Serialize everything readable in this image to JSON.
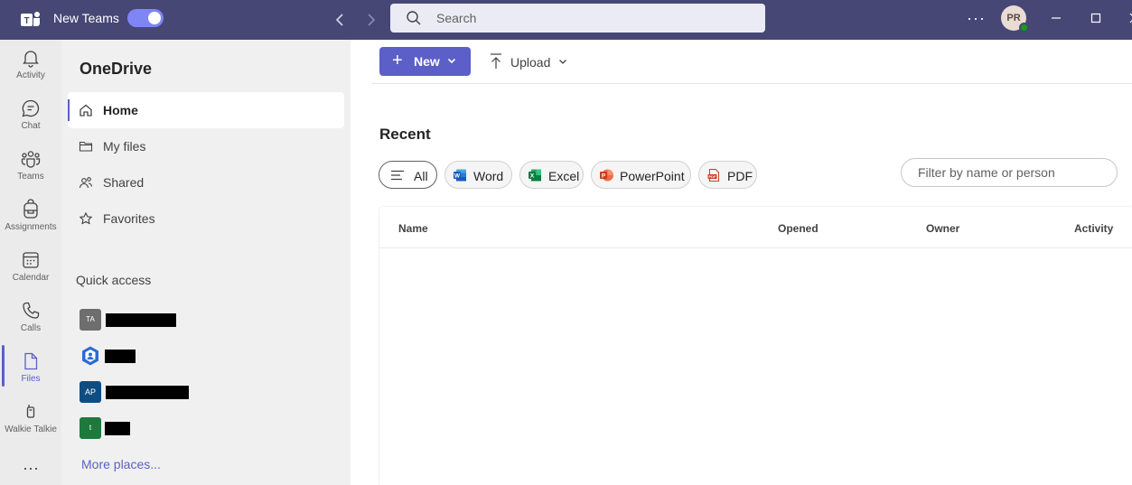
{
  "titlebar": {
    "new_teams_label": "New Teams",
    "toggle_on": true,
    "search_placeholder": "Search",
    "more": "···",
    "avatar_initials": "PR",
    "accent": "#464775"
  },
  "rail": {
    "items": [
      {
        "label": "Activity",
        "icon": "bell-icon"
      },
      {
        "label": "Chat",
        "icon": "chat-icon"
      },
      {
        "label": "Teams",
        "icon": "teams-icon"
      },
      {
        "label": "Assignments",
        "icon": "backpack-icon"
      },
      {
        "label": "Calendar",
        "icon": "calendar-icon"
      },
      {
        "label": "Calls",
        "icon": "phone-icon"
      },
      {
        "label": "Files",
        "icon": "file-icon",
        "active": true
      },
      {
        "label": "Walkie Talkie",
        "icon": "walkie-talkie-icon"
      }
    ],
    "more": "···"
  },
  "navpane": {
    "title": "OneDrive",
    "items": [
      {
        "label": "Home",
        "icon": "home-icon",
        "active": true
      },
      {
        "label": "My files",
        "icon": "folder-icon"
      },
      {
        "label": "Shared",
        "icon": "people-icon"
      },
      {
        "label": "Favorites",
        "icon": "star-icon"
      }
    ],
    "quick_access_title": "Quick access",
    "quick_access": [
      {
        "badge": "TA",
        "badge_color": "#6e6e6e"
      },
      {
        "badge": "",
        "badge_color": "#2b6cd4"
      },
      {
        "badge": "AP",
        "badge_color": "#0f4c81"
      },
      {
        "badge": "t",
        "badge_color": "#1e7a3c"
      }
    ],
    "more_places": "More places..."
  },
  "main": {
    "new_label": "New",
    "upload_label": "Upload",
    "recent_title": "Recent",
    "filters": [
      {
        "label": "All",
        "icon": "list-icon",
        "active": true
      },
      {
        "label": "Word",
        "icon": "word-icon"
      },
      {
        "label": "Excel",
        "icon": "excel-icon"
      },
      {
        "label": "PowerPoint",
        "icon": "powerpoint-icon"
      },
      {
        "label": "PDF",
        "icon": "pdf-icon"
      }
    ],
    "filter_placeholder": "Filter by name or person",
    "columns": [
      "Name",
      "Opened",
      "Owner",
      "Activity"
    ]
  }
}
